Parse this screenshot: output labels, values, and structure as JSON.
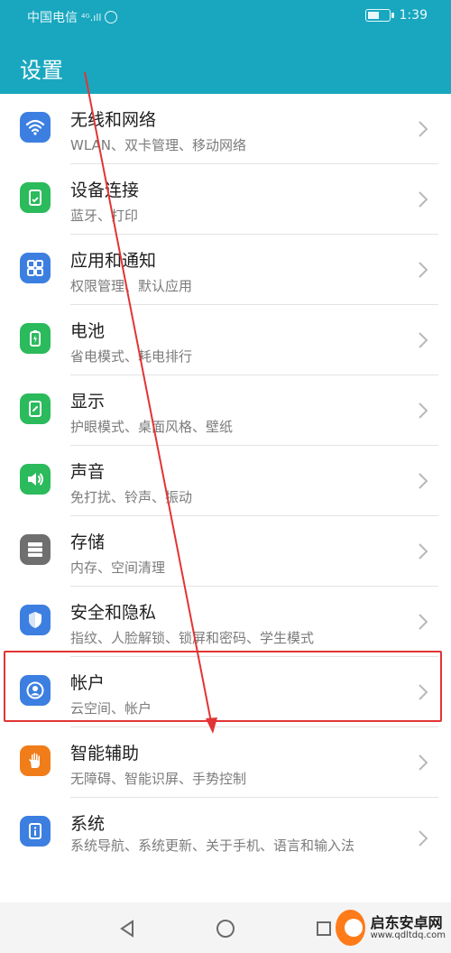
{
  "status_bar": {
    "carrier": "中国电信",
    "signal": "⁴ᴳ.ıll",
    "time": "1:39"
  },
  "header": {
    "title": "设置"
  },
  "settings": [
    {
      "title": "无线和网络",
      "subtitle": "WLAN、双卡管理、移动网络",
      "icon": "wifi-icon",
      "color": "#3c7fe0"
    },
    {
      "title": "设备连接",
      "subtitle": "蓝牙、打印",
      "icon": "device-connect-icon",
      "color": "#2bba5c"
    },
    {
      "title": "应用和通知",
      "subtitle": "权限管理、默认应用",
      "icon": "apps-icon",
      "color": "#3c7fe0"
    },
    {
      "title": "电池",
      "subtitle": "省电模式、耗电排行",
      "icon": "battery-icon",
      "color": "#2bba5c"
    },
    {
      "title": "显示",
      "subtitle": "护眼模式、桌面风格、壁纸",
      "icon": "display-icon",
      "color": "#2bba5c"
    },
    {
      "title": "声音",
      "subtitle": "免打扰、铃声、振动",
      "icon": "sound-icon",
      "color": "#2bba5c"
    },
    {
      "title": "存储",
      "subtitle": "内存、空间清理",
      "icon": "storage-icon",
      "color": "#6f6f6f"
    },
    {
      "title": "安全和隐私",
      "subtitle": "指纹、人脸解锁、锁屏和密码、学生模式",
      "icon": "shield-icon",
      "color": "#3c7fe0"
    },
    {
      "title": "帐户",
      "subtitle": "云空间、帐户",
      "icon": "account-icon",
      "color": "#3c7fe0"
    },
    {
      "title": "智能辅助",
      "subtitle": "无障碍、智能识屏、手势控制",
      "icon": "hand-icon",
      "color": "#f07d1a"
    },
    {
      "title": "系统",
      "subtitle": "系统导航、系统更新、关于手机、语言和输入法",
      "icon": "system-info-icon",
      "color": "#3c7fe0"
    }
  ],
  "watermark": {
    "name": "启东安卓网",
    "url": "www.qdltdq.com"
  }
}
